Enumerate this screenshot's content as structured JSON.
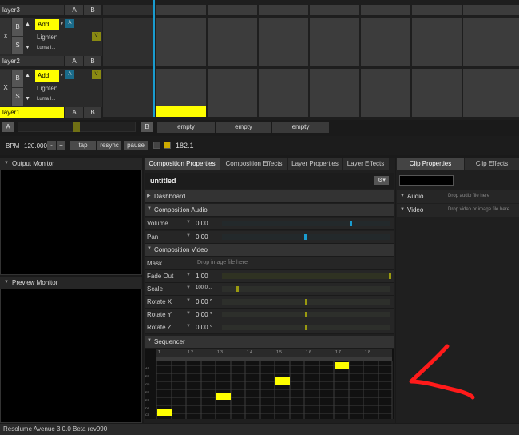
{
  "app": {
    "status_bar": "Resolume Avenue 3.0.0 Beta rev990"
  },
  "colors": {
    "accent_yellow": "#ffff00",
    "accent_blue": "#1a9ccf",
    "annotation_red": "#ff1a1a",
    "olive": "#6b6b0e"
  },
  "layers": [
    {
      "name": "layer3",
      "a": "A",
      "b": "B"
    },
    {
      "name": "layer2",
      "a": "A",
      "b": "B",
      "x": "X",
      "b_btn": "B",
      "s": "S",
      "blend": "Add",
      "alt1": "Lighten",
      "alt2": "Luma I...",
      "a_tag": "A",
      "v_tag": "V"
    },
    {
      "name": "layer1",
      "a": "A",
      "b": "B",
      "x": "X",
      "b_btn": "B",
      "s": "S",
      "blend": "Add",
      "alt1": "Lighten",
      "alt2": "Luma I...",
      "a_tag": "A",
      "v_tag": "V"
    }
  ],
  "crossfader": {
    "a_label": "A",
    "b_label": "B",
    "level": 0.55
  },
  "decks": [
    "empty",
    "empty",
    "empty"
  ],
  "bpm": {
    "label": "BPM",
    "value": "120.000",
    "minus": "-",
    "plus": "+",
    "tap": "tap",
    "resync": "resync",
    "pause": "pause",
    "readout": "182.1"
  },
  "left_panel": {
    "output_monitor": "Output Monitor",
    "preview_monitor": "Preview Monitor"
  },
  "tabs": [
    "Composition Properties",
    "Composition Effects",
    "Layer Properties",
    "Layer Effects"
  ],
  "right_tabs": [
    "Clip Properties",
    "Clip Effects"
  ],
  "composition": {
    "title": "untitled",
    "dashboard": "Dashboard",
    "audio_section": "Composition Audio",
    "volume_label": "Volume",
    "volume_value": "0.00",
    "pan_label": "Pan",
    "pan_value": "0.00",
    "video_section": "Composition Video",
    "mask_label": "Mask",
    "mask_drop": "Drop image file here",
    "fadeout_label": "Fade Out",
    "fadeout_value": "1.00",
    "scale_label": "Scale",
    "scale_value": "100.0...",
    "rotx_label": "Rotate X",
    "rotx_value": "0.00 °",
    "roty_label": "Rotate Y",
    "roty_value": "0.00 °",
    "rotz_label": "Rotate Z",
    "rotz_value": "0.00 °",
    "sequencer_label": "Sequencer",
    "ruler": [
      "1",
      "1.2",
      "1.3",
      "1.4",
      "1.5",
      "1.6",
      "1.7",
      "1.8"
    ],
    "row_labels": [
      "A5",
      "F5",
      "G5",
      "F5",
      "E5",
      "D5",
      "C5"
    ]
  },
  "clip_props": {
    "audio_label": "Audio",
    "audio_drop": "Drop audio file here",
    "video_label": "Video",
    "video_drop": "Drop video or image file here"
  }
}
